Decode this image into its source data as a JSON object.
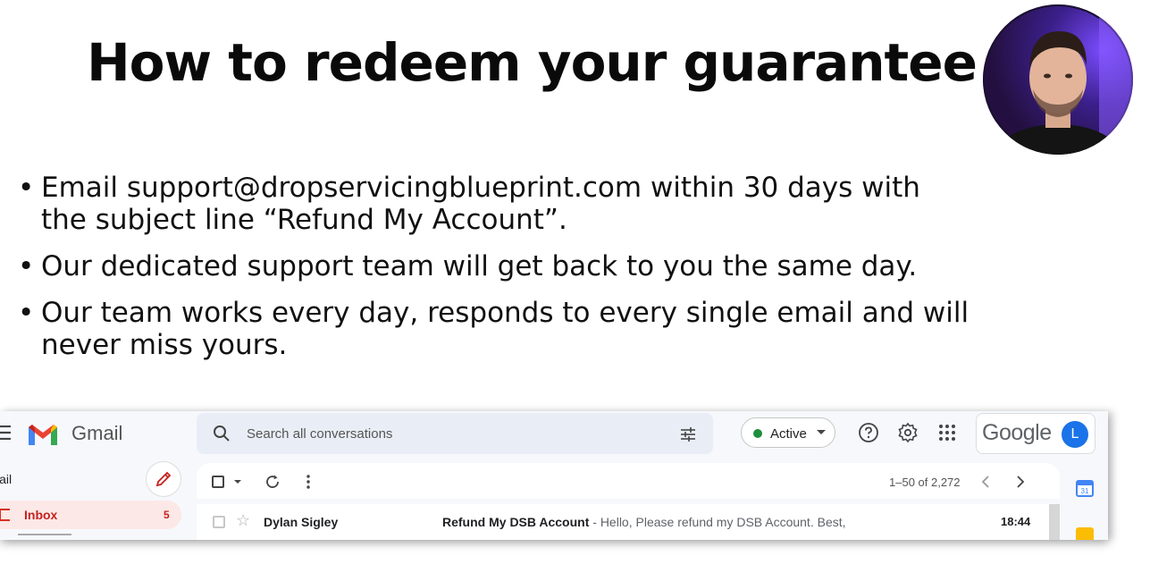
{
  "slide": {
    "title": "How to redeem your guarantee",
    "bullets": [
      {
        "line1": "Email support@dropservicingblueprint.com within 30 days with",
        "line2": "the subject line “Refund My Account”."
      },
      {
        "line1": "Our dedicated support team will get back to you the same day.",
        "line2": ""
      },
      {
        "line1": "Our team works every day, responds to every single email and will",
        "line2": "never miss yours."
      }
    ],
    "bullet_char": "•"
  },
  "gmail": {
    "app_name": "Gmail",
    "search_placeholder": "Search all conversations",
    "status_label": "Active",
    "status_color": "#1e8e3e",
    "google_brand": "Google",
    "user_initial": "L",
    "nav": {
      "section_label": "lail",
      "inbox_label": "Inbox",
      "inbox_count": "5"
    },
    "toolbar": {
      "pager_text": "1–50 of 2,272"
    },
    "emails": [
      {
        "sender": "Dylan Sigley",
        "subject": "Refund My DSB Account",
        "snippet": " - Hello, Please refund my DSB Account. Best,",
        "time": "18:44"
      }
    ],
    "icons": {
      "menu": "hamburger-icon",
      "search": "search-icon",
      "filter": "tune-icon",
      "help": "help-icon",
      "settings": "gear-icon",
      "apps": "apps-grid-icon",
      "compose": "pencil-icon",
      "refresh": "refresh-icon",
      "more": "more-vert-icon",
      "calendar": "calendar-icon",
      "keep": "keep-icon"
    }
  }
}
